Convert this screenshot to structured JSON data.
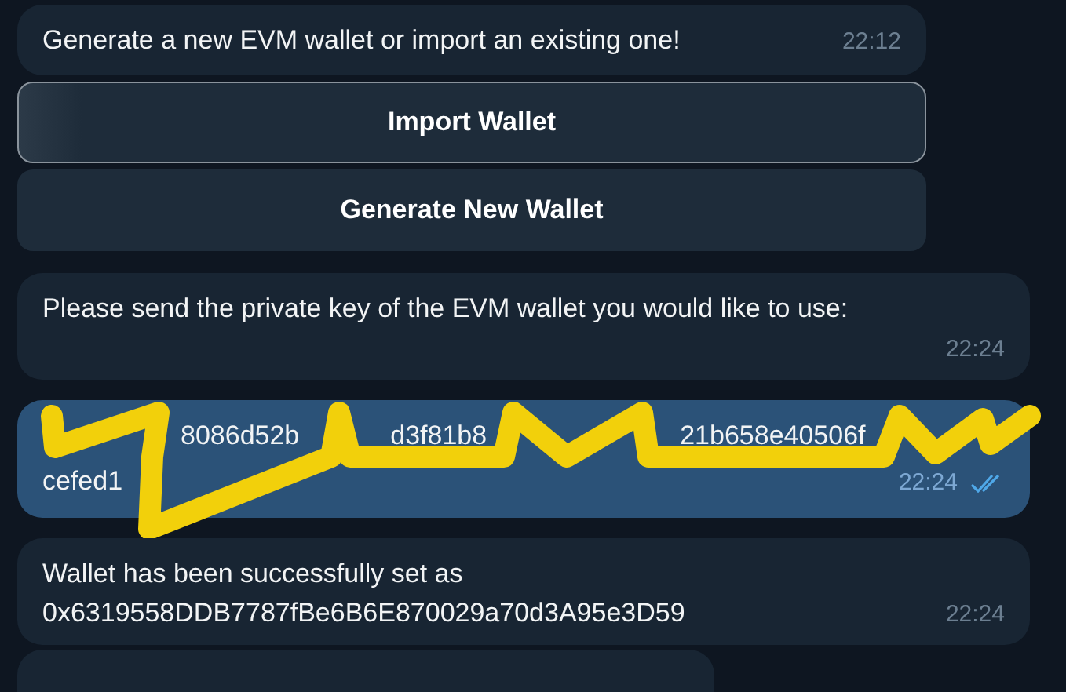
{
  "messages": [
    {
      "kind": "incoming",
      "text": "Generate a new EVM wallet or import an existing one!",
      "time": "22:12",
      "buttons": [
        {
          "label": "Import Wallet",
          "highlighted": true
        },
        {
          "label": "Generate New Wallet",
          "highlighted": false
        }
      ]
    },
    {
      "kind": "incoming",
      "text": "Please send the private key of the EVM wallet you would like to use:",
      "time": "22:24"
    },
    {
      "kind": "outgoing",
      "redacted": true,
      "fragments": [
        [
          "8086d52b",
          "d3f81b8",
          "21b658e40506f"
        ],
        [
          "cefed1"
        ]
      ],
      "time": "22:24",
      "read": true
    },
    {
      "kind": "incoming",
      "lines": [
        "Wallet has been successfully set as",
        "0x6319558DDB7787fBe6B6E870029a70d3A95e3D59"
      ],
      "time": "22:24"
    },
    {
      "kind": "partial"
    }
  ]
}
